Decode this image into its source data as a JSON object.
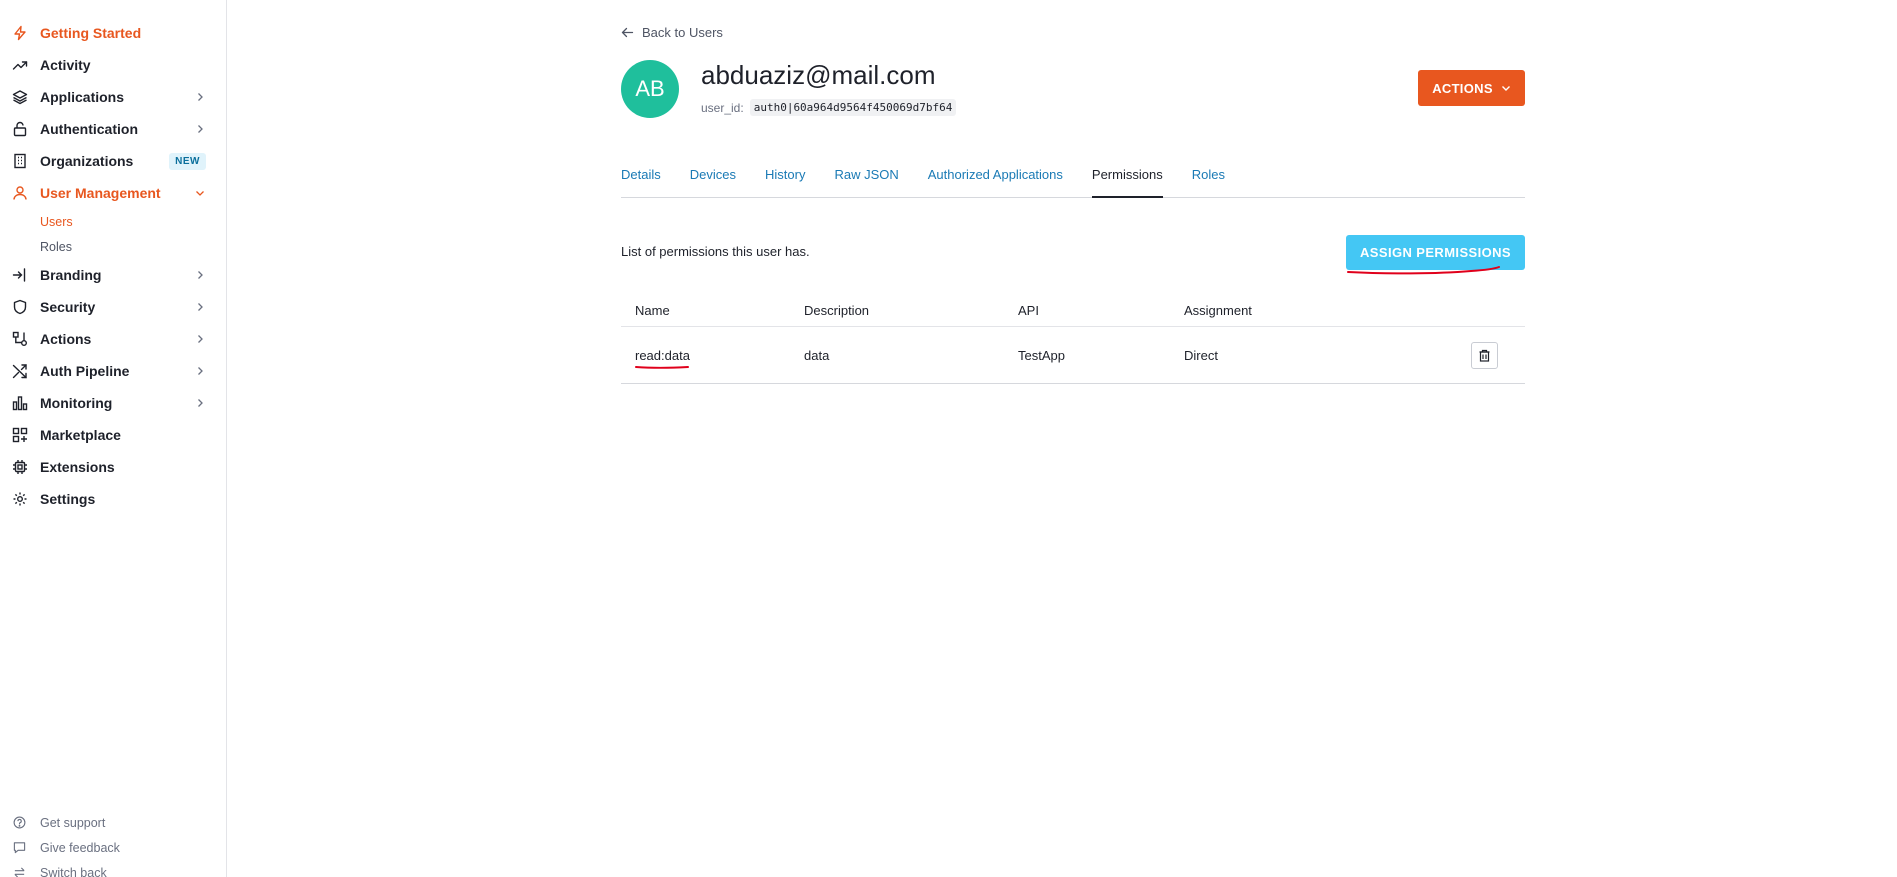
{
  "sidebar": {
    "items": [
      {
        "label": "Getting Started",
        "icon": "bolt-icon",
        "active": true
      },
      {
        "label": "Activity",
        "icon": "trending-up-icon"
      },
      {
        "label": "Applications",
        "icon": "layers-icon",
        "chevron": true
      },
      {
        "label": "Authentication",
        "icon": "lock-icon",
        "chevron": true
      },
      {
        "label": "Organizations",
        "icon": "building-icon",
        "badge": "NEW"
      },
      {
        "label": "User Management",
        "icon": "user-icon",
        "active": true,
        "expanded": true
      },
      {
        "label": "Branding",
        "icon": "sign-in-icon",
        "chevron": true
      },
      {
        "label": "Security",
        "icon": "shield-icon",
        "chevron": true
      },
      {
        "label": "Actions",
        "icon": "flow-icon",
        "chevron": true
      },
      {
        "label": "Auth Pipeline",
        "icon": "shuffle-icon",
        "chevron": true
      },
      {
        "label": "Monitoring",
        "icon": "bar-chart-icon",
        "chevron": true
      },
      {
        "label": "Marketplace",
        "icon": "grid-plus-icon"
      },
      {
        "label": "Extensions",
        "icon": "chip-icon"
      },
      {
        "label": "Settings",
        "icon": "gear-icon"
      }
    ],
    "user_management_sub": [
      {
        "label": "Users",
        "active": true
      },
      {
        "label": "Roles"
      }
    ],
    "footer": [
      {
        "label": "Get support",
        "icon": "help-circle-icon"
      },
      {
        "label": "Give feedback",
        "icon": "message-icon"
      },
      {
        "label": "Switch back",
        "icon": "switch-icon"
      }
    ]
  },
  "header": {
    "back_label": "Back to Users",
    "avatar_initials": "AB",
    "email": "abduaziz@mail.com",
    "user_id_label": "user_id:",
    "user_id_value": "auth0|60a964d9564f450069d7bf64",
    "actions_label": "ACTIONS"
  },
  "tabs": [
    {
      "label": "Details"
    },
    {
      "label": "Devices"
    },
    {
      "label": "History"
    },
    {
      "label": "Raw JSON"
    },
    {
      "label": "Authorized Applications"
    },
    {
      "label": "Permissions",
      "active": true
    },
    {
      "label": "Roles"
    }
  ],
  "permissions": {
    "description": "List of permissions this user has.",
    "assign_label": "ASSIGN PERMISSIONS",
    "columns": [
      "Name",
      "Description",
      "API",
      "Assignment"
    ],
    "rows": [
      {
        "name": "read:data",
        "description": "data",
        "api": "TestApp",
        "assignment": "Direct"
      }
    ]
  },
  "colors": {
    "accent_orange": "#e8571f",
    "assign_blue": "#44c7f4",
    "avatar_green": "#1fbf9c",
    "link_blue": "#1a7ab5",
    "annotation_red": "#e0001b"
  }
}
